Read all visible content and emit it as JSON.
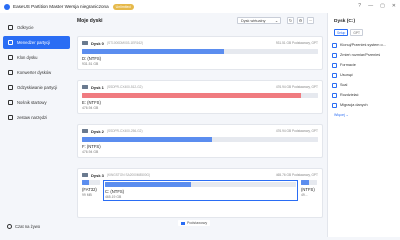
{
  "titlebar": {
    "title": "EaseUS Partition Master Wersja niegraniczona",
    "badge": "Unlimited",
    "buttons": [
      "?",
      "—",
      "▢",
      "✕"
    ]
  },
  "sidebar": {
    "items": [
      {
        "label": "Odkrycie",
        "icon": "discover-icon"
      },
      {
        "label": "Menedżer partycji",
        "icon": "partition-manager-icon",
        "active": true
      },
      {
        "label": "Klon dysku",
        "icon": "disk-clone-icon"
      },
      {
        "label": "Konwerter dysków",
        "icon": "disk-converter-icon"
      },
      {
        "label": "Odzyskiwanie partycji",
        "icon": "partition-recovery-icon"
      },
      {
        "label": "Nośnik startowy",
        "icon": "boot-media-icon"
      },
      {
        "label": "zestaw narzędzi",
        "icon": "toolkit-icon"
      }
    ],
    "chat_label": "Czat na żywo"
  },
  "main": {
    "title": "Moje dyski",
    "view_select": "Dysk wirtualny",
    "legend": "Podstawowy",
    "disks": [
      {
        "name": "Dysk 0",
        "model": "(ST1000DM003-1ER162)",
        "size": "931.51 GB Podstawowy, GPT",
        "part_name": "D: (NTFS)",
        "part_size": "931.51 GB",
        "fill_ratio": 0.6,
        "fill_color": "#5b8def"
      },
      {
        "name": "Dysk 1",
        "model": "(SSDPR-CX400-512-G2)",
        "size": "476.94 GB Podstawowy, GPT",
        "part_name": "E: (NTFS)",
        "part_size": "476.94 GB",
        "fill_ratio": 0.93,
        "fill_color": "#f07b80"
      },
      {
        "name": "Dysk 2",
        "model": "(SSDPR-CX400-256-G2)",
        "size": "476.94 GB Podstawowy, GPT",
        "part_name": "F: (NTFS)",
        "part_size": "476.94 GB",
        "fill_ratio": 0.55,
        "fill_color": "#5b8def"
      },
      {
        "name": "Dysk 3",
        "model": "(KINGSTON SA2000M8500G)",
        "size": "465.76 GB Podstawowy, GPT",
        "parts": [
          {
            "name": "(FAT32)",
            "size": "99 MB",
            "fill_ratio": 0.4
          },
          {
            "name": "C: (NTFS)",
            "size": "465.19 GB",
            "fill_ratio": 0.45,
            "selected": true
          },
          {
            "name": "(NTFS)",
            "size": "49...",
            "fill_ratio": 0.5
          }
        ]
      }
    ]
  },
  "right": {
    "title": "Dysk (C:)",
    "tags": [
      "Setup",
      "GPT"
    ],
    "actions": [
      {
        "label": "Klonuj/Przenieś system o...",
        "icon": "clone-system-icon"
      },
      {
        "label": "Zmień rozmiar/Przenieś",
        "icon": "resize-icon"
      },
      {
        "label": "Formacie",
        "icon": "format-icon"
      },
      {
        "label": "Usunąć",
        "icon": "delete-icon"
      },
      {
        "label": "Scal",
        "icon": "merge-icon"
      },
      {
        "label": "Rozdzielać",
        "icon": "split-icon"
      },
      {
        "label": "Migracja danych",
        "icon": "migrate-icon"
      }
    ],
    "more": "Więcej ⌄"
  }
}
